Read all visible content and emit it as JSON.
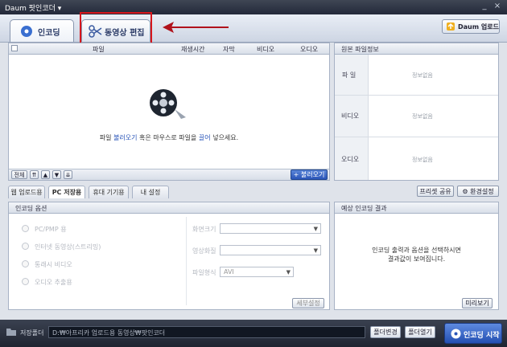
{
  "window": {
    "title": "Daum 팟인코더 ▾",
    "minimize": "_",
    "close": "×"
  },
  "tabs": [
    {
      "label": "인코딩"
    },
    {
      "label": "동영상 편집"
    }
  ],
  "daum_upload": "Daum 업로드",
  "file_table": {
    "columns": [
      "파일",
      "재생시간",
      "자막",
      "비디오",
      "오디오"
    ],
    "empty_message_parts": [
      "파일 ",
      "불러오기",
      " 혹은 마우스로 파일을 ",
      "끌어",
      " 넣으세요."
    ],
    "page_label": "전체",
    "load_button": "불러오기"
  },
  "source_info": {
    "header": "원본 파일정보",
    "rows": [
      {
        "key": "파  일",
        "value": "정보없음"
      },
      {
        "key": "비디오",
        "value": "정보없음"
      },
      {
        "key": "오디오",
        "value": "정보없음"
      }
    ]
  },
  "sub_tabs": [
    "웹 업로드용",
    "PC 저장용",
    "휴대 기기용",
    "내 설정"
  ],
  "preset_share": "프리셋 공유",
  "settings": "환경설정",
  "encoding_options": {
    "header": "인코딩 옵션",
    "radios": [
      "PC/PMP 용",
      "인터넷 동영상(스트리밍)",
      "통래시 비디오",
      "오디오 추출용"
    ],
    "fields": [
      {
        "label": "화면크기",
        "value": ""
      },
      {
        "label": "영상화질",
        "value": ""
      },
      {
        "label": "파일형식",
        "value": "AVI"
      }
    ],
    "detail_button": "세부설정"
  },
  "expected_result": {
    "header": "예상 인코딩 결과",
    "message_line1": "인코딩 출력과 옵션을 선택하시면",
    "message_line2": "결과값이 보여집니다.",
    "preview_button": "미리보기"
  },
  "bottom": {
    "folder_label": "저장폴더",
    "path": "D:₩아프리카 업로드용 동영상₩팟인코더",
    "change_folder": "폴더변경",
    "open_folder": "폴더열기",
    "start": "인코딩 시작"
  },
  "colors": {
    "highlight": "#d7161c",
    "accent": "#2a55b8"
  }
}
